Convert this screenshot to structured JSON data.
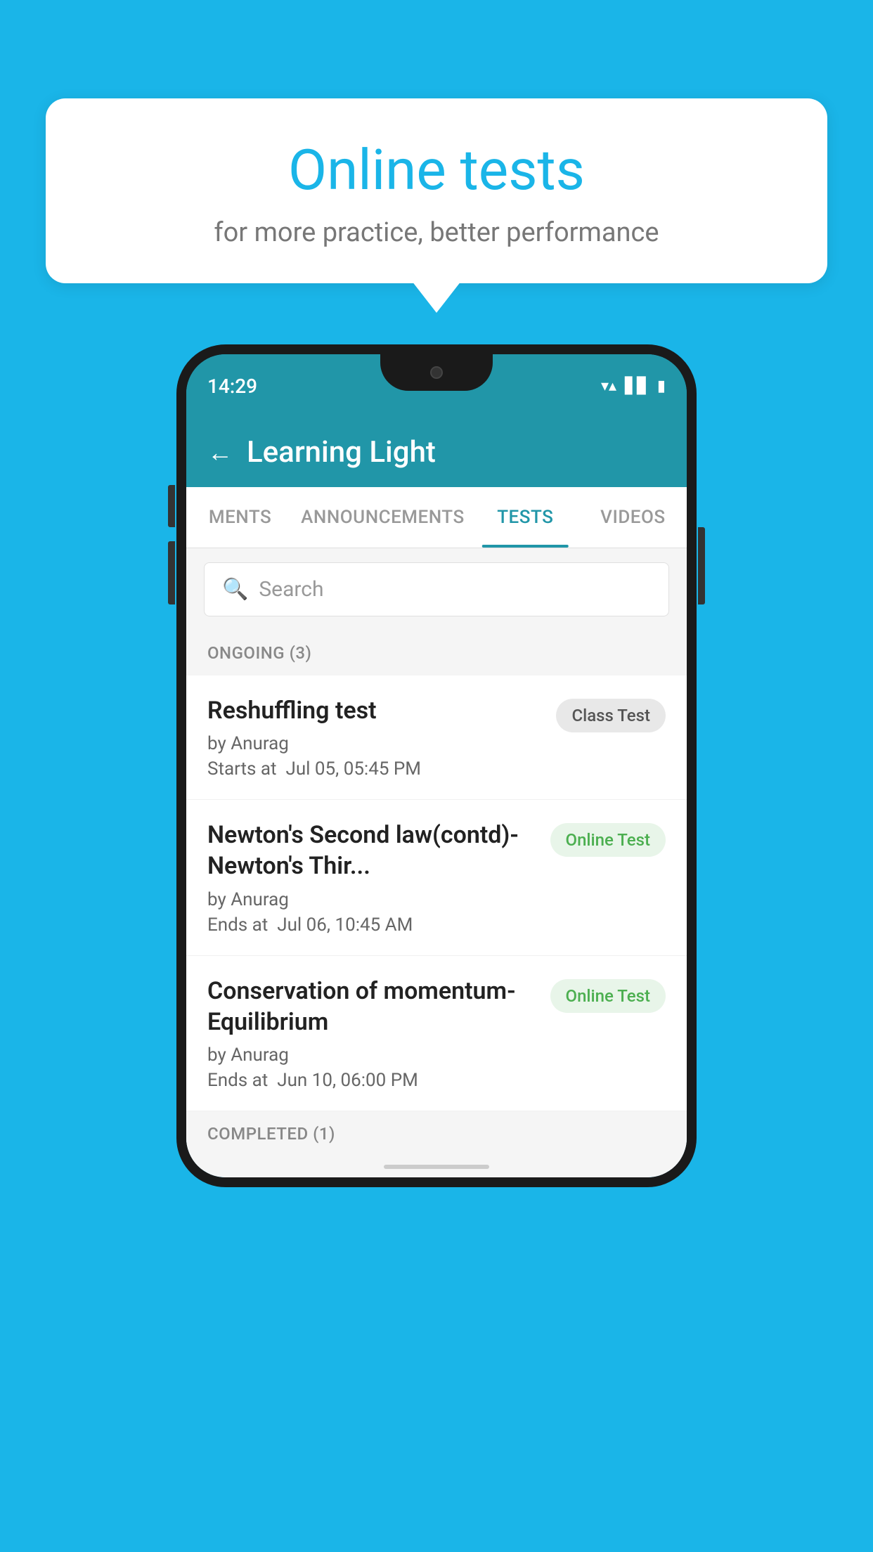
{
  "background": {
    "color": "#1ab5e8"
  },
  "speech_bubble": {
    "title": "Online tests",
    "subtitle": "for more practice, better performance"
  },
  "phone": {
    "status_bar": {
      "time": "14:29",
      "icons": [
        "wifi",
        "signal",
        "battery"
      ]
    },
    "app_header": {
      "back_label": "←",
      "title": "Learning Light"
    },
    "tabs": [
      {
        "label": "MENTS",
        "active": false
      },
      {
        "label": "ANNOUNCEMENTS",
        "active": false
      },
      {
        "label": "TESTS",
        "active": true
      },
      {
        "label": "VIDEOS",
        "active": false
      }
    ],
    "search": {
      "placeholder": "Search",
      "icon": "🔍"
    },
    "sections": [
      {
        "label": "ONGOING (3)",
        "items": [
          {
            "name": "Reshuffling test",
            "author": "by Anurag",
            "time_label": "Starts at",
            "time": "Jul 05, 05:45 PM",
            "badge": "Class Test",
            "badge_type": "class"
          },
          {
            "name": "Newton's Second law(contd)-Newton's Thir...",
            "author": "by Anurag",
            "time_label": "Ends at",
            "time": "Jul 06, 10:45 AM",
            "badge": "Online Test",
            "badge_type": "online"
          },
          {
            "name": "Conservation of momentum-Equilibrium",
            "author": "by Anurag",
            "time_label": "Ends at",
            "time": "Jun 10, 06:00 PM",
            "badge": "Online Test",
            "badge_type": "online"
          }
        ]
      }
    ],
    "completed_label": "COMPLETED (1)"
  }
}
